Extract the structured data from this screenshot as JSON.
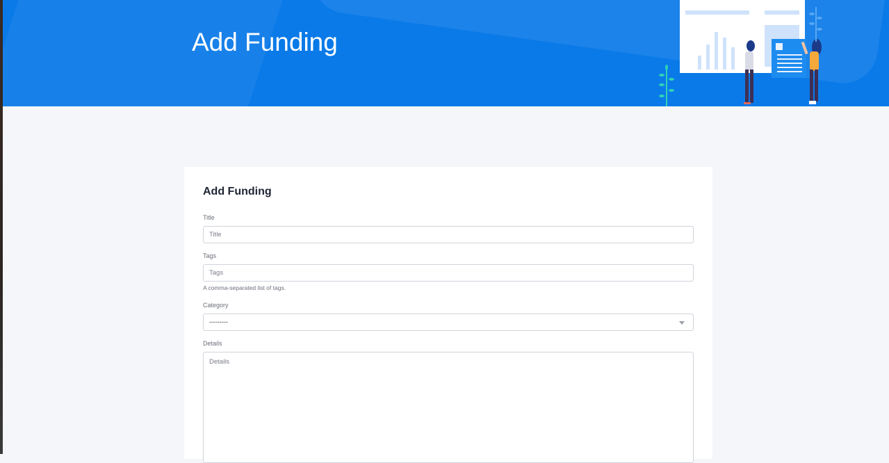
{
  "hero": {
    "title": "Add Funding"
  },
  "form": {
    "heading": "Add Funding",
    "title_label": "Title",
    "title_placeholder": "Title",
    "title_value": "",
    "tags_label": "Tags",
    "tags_placeholder": "Tags",
    "tags_value": "",
    "tags_help": "A comma-separated list of tags.",
    "category_label": "Category",
    "category_selected": "---------",
    "details_label": "Details",
    "details_placeholder": "Details",
    "details_value": ""
  },
  "colors": {
    "hero_bg": "#0a7ae8",
    "page_bg": "#f5f6f9",
    "card_bg": "#ffffff",
    "heading_text": "#1e2433"
  },
  "icons": {
    "select_caret": "chevron-down-icon",
    "hero_art": "dashboard-presentation-illustration"
  }
}
